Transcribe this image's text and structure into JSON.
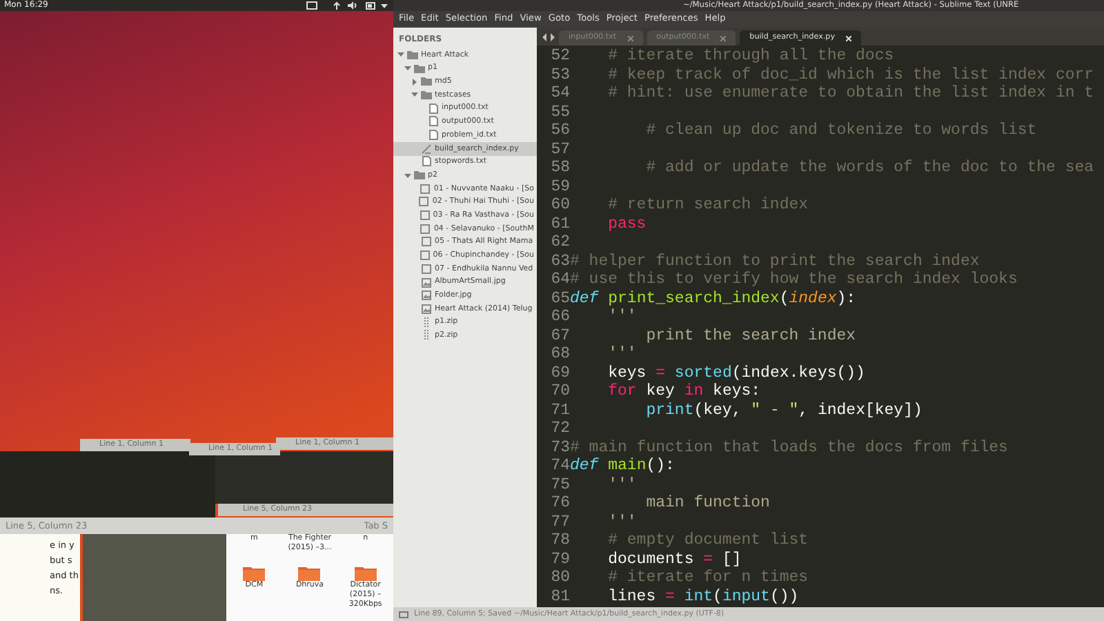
{
  "top_bar": {
    "clock": "Mon 16:29"
  },
  "desktop": {
    "stub_statuses": [
      "Line 1, Column 1",
      "Line 1, Column 1",
      "Line 1, Column 1"
    ],
    "editor_status": "Line 5, Column 23",
    "status_bar": {
      "left": "Line 5, Column 23",
      "right": "Tab S"
    },
    "document_lines": [
      "e in y",
      "but s",
      "and th",
      "ns."
    ],
    "file_manager": {
      "labels": [
        "m",
        "The Fighter (2015) –3...",
        "n"
      ],
      "folders": [
        "DCM",
        "Dhruva",
        "Dictator (2015) – 320Kbps"
      ]
    }
  },
  "editor": {
    "title": "~/Music/Heart Attack/p1/build_search_index.py (Heart Attack) - Sublime Text (UNRE",
    "menu": [
      "File",
      "Edit",
      "Selection",
      "Find",
      "View",
      "Goto",
      "Tools",
      "Project",
      "Preferences",
      "Help"
    ],
    "sidebar": {
      "header": "FOLDERS",
      "tree": [
        {
          "label": "Heart Attack",
          "kind": "folder",
          "expanded": true,
          "selected": false,
          "children": [
            {
              "label": "p1",
              "kind": "folder",
              "expanded": true,
              "selected": false,
              "children": [
                {
                  "label": "md5",
                  "kind": "folder",
                  "expanded": false,
                  "selected": false
                },
                {
                  "label": "testcases",
                  "kind": "folder",
                  "expanded": true,
                  "selected": false,
                  "children": [
                    {
                      "label": "input000.txt",
                      "kind": "file",
                      "selected": false
                    },
                    {
                      "label": "output000.txt",
                      "kind": "file",
                      "selected": false
                    },
                    {
                      "label": "problem_id.txt",
                      "kind": "file",
                      "selected": false
                    }
                  ]
                },
                {
                  "label": "build_search_index.py",
                  "kind": "script",
                  "selected": true
                },
                {
                  "label": "stopwords.txt",
                  "kind": "file",
                  "selected": false
                }
              ]
            },
            {
              "label": "p2",
              "kind": "folder",
              "expanded": true,
              "selected": false,
              "children": [
                {
                  "label": "01 - Nuvvante Naaku - [So",
                  "kind": "audio",
                  "selected": false
                },
                {
                  "label": "02 - Thuhi Hai Thuhi - [Sou",
                  "kind": "audio",
                  "selected": false
                },
                {
                  "label": "03 - Ra Ra Vasthava - [Sou",
                  "kind": "audio",
                  "selected": false
                },
                {
                  "label": "04 - Selavanuko - [SouthM",
                  "kind": "audio",
                  "selected": false
                },
                {
                  "label": "05 - Thats All Right Mama",
                  "kind": "audio",
                  "selected": false
                },
                {
                  "label": "06 - Chupinchandey - [Sou",
                  "kind": "audio",
                  "selected": false
                },
                {
                  "label": "07 - Endhukila Nannu Ved",
                  "kind": "audio",
                  "selected": false
                },
                {
                  "label": "AlbumArtSmall.jpg",
                  "kind": "image",
                  "selected": false
                },
                {
                  "label": "Folder.jpg",
                  "kind": "image",
                  "selected": false
                },
                {
                  "label": "Heart Attack (2014) Telug",
                  "kind": "image",
                  "selected": false
                },
                {
                  "label": "p1.zip",
                  "kind": "zip",
                  "selected": false
                },
                {
                  "label": "p2.zip",
                  "kind": "zip",
                  "selected": false
                }
              ]
            }
          ]
        }
      ]
    },
    "tabs": [
      {
        "label": "input000.txt",
        "selected": false
      },
      {
        "label": "output000.txt",
        "selected": false
      },
      {
        "label": "build_search_index.py",
        "selected": true
      }
    ],
    "lines": [
      {
        "number": "52",
        "tokens": [
          {
            "kind": "comment",
            "text": "    # iterate through all the docs"
          }
        ]
      },
      {
        "number": "53",
        "tokens": [
          {
            "kind": "comment",
            "text": "    # keep track of doc_id which is the list index corr"
          }
        ]
      },
      {
        "number": "54",
        "tokens": [
          {
            "kind": "comment",
            "text": "    # hint: use enumerate to obtain the list index in t"
          }
        ]
      },
      {
        "number": "55"
      },
      {
        "number": "56",
        "tokens": [
          {
            "kind": "comment",
            "text": "        # clean up doc and tokenize to words list"
          }
        ]
      },
      {
        "number": "57"
      },
      {
        "number": "58",
        "tokens": [
          {
            "kind": "comment",
            "text": "        # add or update the words of the doc to the sea"
          }
        ]
      },
      {
        "number": "59"
      },
      {
        "number": "60",
        "tokens": [
          {
            "kind": "comment",
            "text": "    # return search index"
          }
        ]
      },
      {
        "number": "61",
        "tokens": [
          {
            "kind": "keyword",
            "text": "    pass"
          }
        ]
      },
      {
        "number": "62"
      },
      {
        "number": "63",
        "tokens": [
          {
            "kind": "comment",
            "text": "# helper function to print the search index"
          }
        ]
      },
      {
        "number": "64",
        "tokens": [
          {
            "kind": "comment",
            "text": "# use this to verify how the search index looks"
          }
        ]
      },
      {
        "number": "65",
        "tokens": [
          {
            "kind": "storage",
            "text": "def "
          },
          {
            "kind": "function",
            "text": "print_search_index"
          },
          {
            "kind": "plain",
            "text": "("
          },
          {
            "kind": "parameter",
            "text": "index"
          },
          {
            "kind": "plain",
            "text": "):"
          }
        ]
      },
      {
        "number": "66",
        "tokens": [
          {
            "kind": "docstring",
            "text": "    '''"
          }
        ]
      },
      {
        "number": "67",
        "tokens": [
          {
            "kind": "docstring",
            "text": "        print the search index"
          }
        ]
      },
      {
        "number": "68",
        "tokens": [
          {
            "kind": "docstring",
            "text": "    '''"
          }
        ]
      },
      {
        "number": "69",
        "tokens": [
          {
            "kind": "plain",
            "text": "    keys "
          },
          {
            "kind": "operator",
            "text": "="
          },
          {
            "kind": "builtin",
            "text": " sorted"
          },
          {
            "kind": "plain",
            "text": "(index.keys())"
          }
        ]
      },
      {
        "number": "70",
        "tokens": [
          {
            "kind": "keyword",
            "text": "    for"
          },
          {
            "kind": "plain",
            "text": " key "
          },
          {
            "kind": "keyword",
            "text": "in"
          },
          {
            "kind": "plain",
            "text": " keys:"
          }
        ]
      },
      {
        "number": "71",
        "tokens": [
          {
            "kind": "builtin",
            "text": "        print"
          },
          {
            "kind": "plain",
            "text": "(key, "
          },
          {
            "kind": "string",
            "text": "\" - \""
          },
          {
            "kind": "plain",
            "text": ", index[key])"
          }
        ]
      },
      {
        "number": "72"
      },
      {
        "number": "73",
        "tokens": [
          {
            "kind": "comment",
            "text": "# main function that loads the docs from files"
          }
        ]
      },
      {
        "number": "74",
        "tokens": [
          {
            "kind": "storage",
            "text": "def "
          },
          {
            "kind": "function",
            "text": "main"
          },
          {
            "kind": "plain",
            "text": "():"
          }
        ]
      },
      {
        "number": "75",
        "tokens": [
          {
            "kind": "docstring",
            "text": "    '''"
          }
        ]
      },
      {
        "number": "76",
        "tokens": [
          {
            "kind": "docstring",
            "text": "        main function"
          }
        ]
      },
      {
        "number": "77",
        "tokens": [
          {
            "kind": "docstring",
            "text": "    '''"
          }
        ]
      },
      {
        "number": "78",
        "tokens": [
          {
            "kind": "comment",
            "text": "    # empty document list"
          }
        ]
      },
      {
        "number": "79",
        "tokens": [
          {
            "kind": "plain",
            "text": "    documents "
          },
          {
            "kind": "operator",
            "text": "="
          },
          {
            "kind": "plain",
            "text": " []"
          }
        ]
      },
      {
        "number": "80",
        "tokens": [
          {
            "kind": "comment",
            "text": "    # iterate for n times"
          }
        ]
      },
      {
        "number": "81",
        "tokens": [
          {
            "kind": "plain",
            "text": "    lines "
          },
          {
            "kind": "operator",
            "text": "="
          },
          {
            "kind": "builtin",
            "text": " int"
          },
          {
            "kind": "plain",
            "text": "("
          },
          {
            "kind": "builtin",
            "text": "input"
          },
          {
            "kind": "plain",
            "text": "())"
          }
        ]
      }
    ],
    "status_bar": "Line 89, Column 5; Saved ~/Music/Heart Attack/p1/build_search_index.py (UTF-8)"
  }
}
